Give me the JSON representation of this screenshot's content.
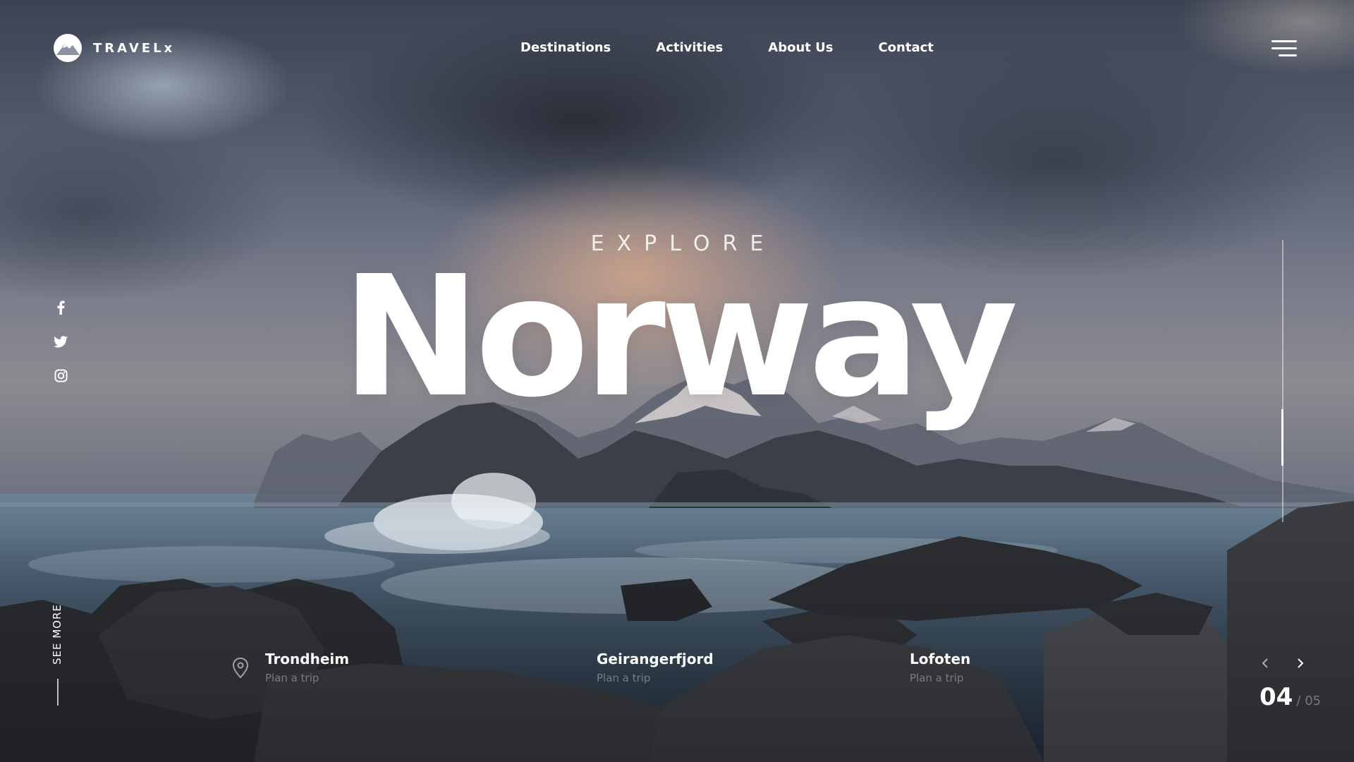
{
  "brand": {
    "name": "TRAVELx",
    "logo_icon": "mountain-logo-icon"
  },
  "nav": {
    "items": [
      {
        "label": "Destinations"
      },
      {
        "label": "Activities"
      },
      {
        "label": "About Us"
      },
      {
        "label": "Contact"
      }
    ],
    "menu_icon": "hamburger-menu-icon"
  },
  "hero": {
    "eyebrow": "EXPLORE",
    "title": "Norway"
  },
  "socials": [
    {
      "icon": "facebook-icon"
    },
    {
      "icon": "twitter-icon"
    },
    {
      "icon": "instagram-icon"
    }
  ],
  "see_more": {
    "label": "SEE MORE"
  },
  "destinations": [
    {
      "name": "Trondheim",
      "subtitle": "Plan a trip",
      "icon": "location-pin-icon"
    },
    {
      "name": "Geirangerfjord",
      "subtitle": "Plan a trip"
    },
    {
      "name": "Lofoten",
      "subtitle": "Plan a trip"
    }
  ],
  "slider": {
    "current": "04",
    "total": "/ 05",
    "prev_icon": "chevron-left-icon",
    "next_icon": "chevron-right-icon"
  },
  "colors": {
    "accent": "#ffffff",
    "overlay": "#1c222c"
  }
}
